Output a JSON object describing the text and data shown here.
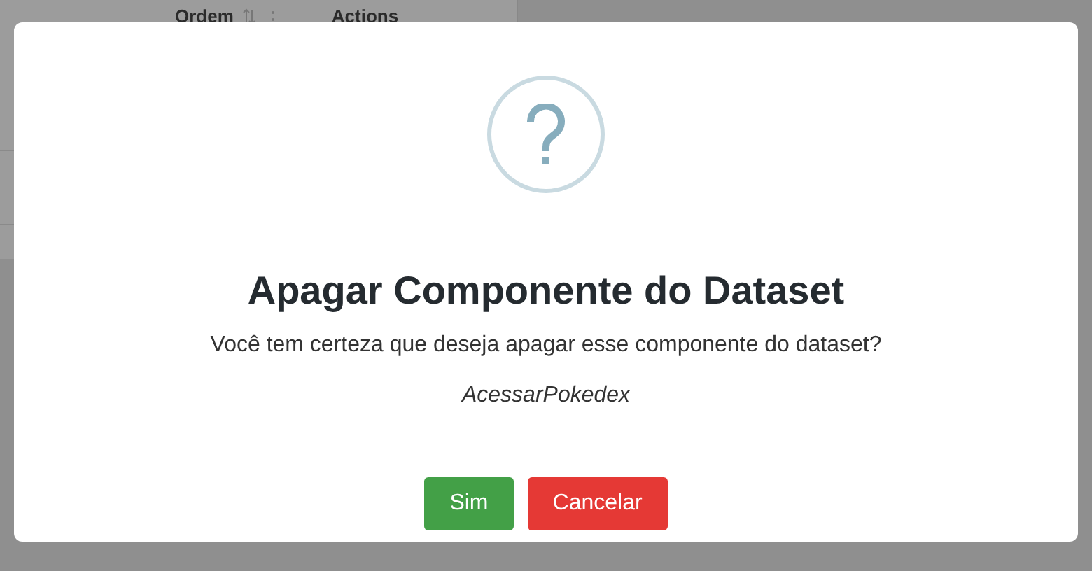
{
  "background_table": {
    "columns": [
      {
        "label": "Ordem",
        "sortable": true
      },
      {
        "label": "Actions",
        "sortable": false
      }
    ]
  },
  "dialog": {
    "title": "Apagar Componente do Dataset",
    "message": "Você tem certeza que deseja apagar esse componente do dataset?",
    "item": "AcessarPokedex",
    "buttons": [
      {
        "label": "Sim",
        "kind": "confirm"
      },
      {
        "label": "Cancelar",
        "kind": "cancel"
      }
    ]
  }
}
